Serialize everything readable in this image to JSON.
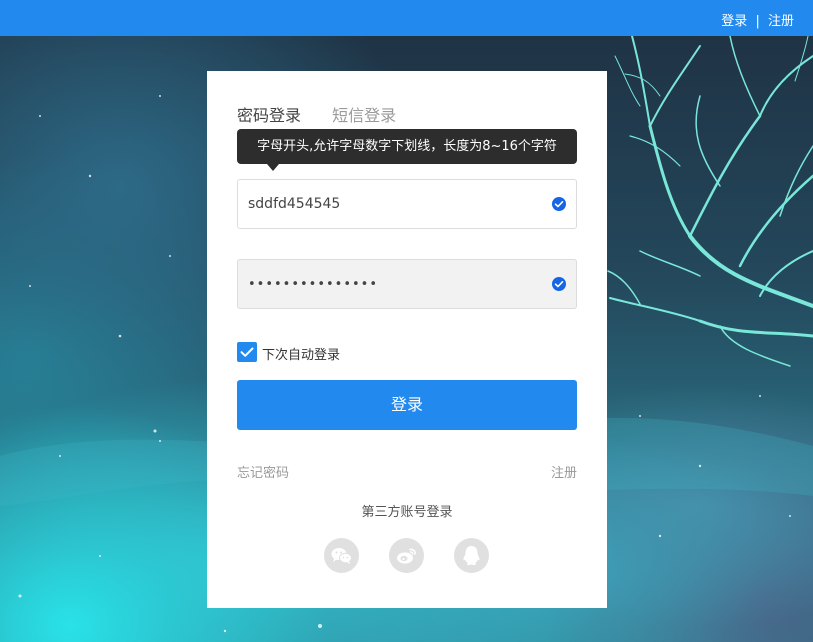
{
  "topbar": {
    "login_link": "登录",
    "separator": "|",
    "register_link": "注册",
    "color": "#2289ee"
  },
  "login_card": {
    "tabs": [
      {
        "label": "密码登录",
        "active": true
      },
      {
        "label": "短信登录",
        "active": false
      }
    ],
    "tooltip": "字母开头,允许字母数字下划线，长度为8~16个字符",
    "username": {
      "value": "sddfd454545",
      "valid": true
    },
    "password": {
      "value": "•••••••••••••••",
      "valid": true
    },
    "remember": {
      "label": "下次自动登录",
      "checked": true
    },
    "submit_label": "登录",
    "forgot_label": "忘记密码",
    "register_label": "注册",
    "third_party": {
      "title": "第三方账号登录",
      "providers": [
        {
          "name": "wechat",
          "icon": "wechat-icon"
        },
        {
          "name": "weibo",
          "icon": "weibo-icon"
        },
        {
          "name": "qq",
          "icon": "qq-icon"
        }
      ]
    }
  },
  "colors": {
    "accent": "#2289ee",
    "valid_badge": "#1565e6",
    "tooltip_bg": "#2d2d2d"
  }
}
